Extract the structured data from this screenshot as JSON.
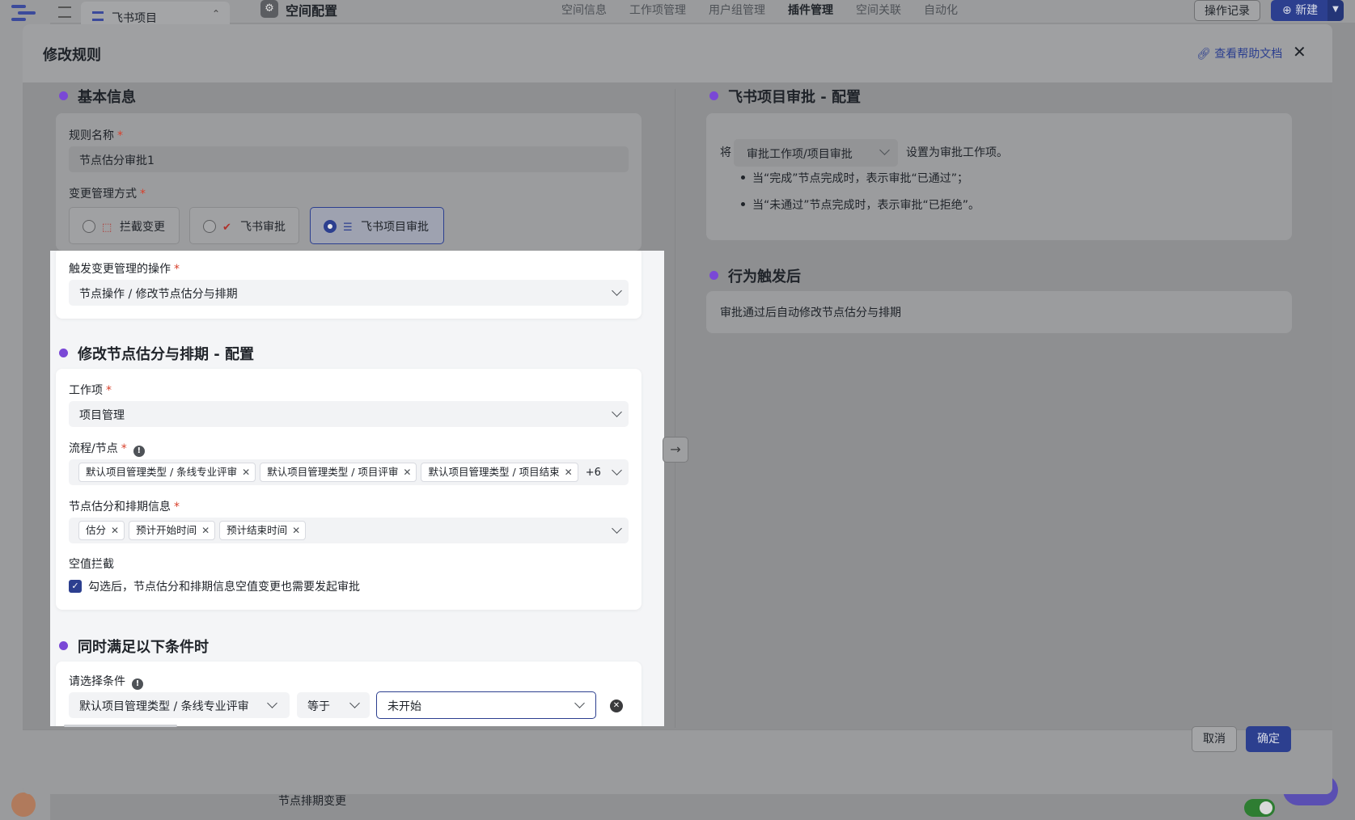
{
  "app": {
    "project_name": "飞书项目",
    "space_title": "空间配置",
    "tabs": [
      "空间信息",
      "工作项管理",
      "用户组管理",
      "插件管理",
      "空间关联",
      "自动化"
    ],
    "active_tab": "插件管理",
    "op_log": "操作记录",
    "new_button": "新建",
    "bottom_row": "节点排期变更"
  },
  "modal": {
    "title": "修改规则",
    "help_link": "查看帮助文档",
    "close": "✕",
    "cancel": "取消",
    "confirm": "确定"
  },
  "basic": {
    "section_title": "基本信息",
    "rule_name_label": "规则名称",
    "rule_name_value": "节点估分审批1",
    "change_mode_label": "变更管理方式",
    "modes": [
      {
        "label": "拦截变更",
        "selected": false
      },
      {
        "label": "飞书审批",
        "selected": false
      },
      {
        "label": "飞书项目审批",
        "selected": true
      }
    ],
    "trigger_label": "触发变更管理的操作",
    "trigger_value": "节点操作 / 修改节点估分与排期"
  },
  "config": {
    "section_title": "修改节点估分与排期 - 配置",
    "workitem_label": "工作项",
    "workitem_value": "项目管理",
    "flow_label": "流程/节点",
    "flow_tags": [
      "默认项目管理类型 / 条线专业评审",
      "默认项目管理类型 / 项目评审",
      "默认项目管理类型 / 项目结束"
    ],
    "flow_more": "+6",
    "schedule_label": "节点估分和排期信息",
    "schedule_tags": [
      "估分",
      "预计开始时间",
      "预计结束时间"
    ],
    "null_label": "空值拦截",
    "null_checkbox_text": "勾选后，节点估分和排期信息空值变更也需要发起审批",
    "null_checked": true
  },
  "conditions": {
    "section_title": "同时满足以下条件时",
    "select_label": "请选择条件",
    "field_value": "默认项目管理类型 / 条线专业评审",
    "operator_value": "等于",
    "status_value": "未开始"
  },
  "approval": {
    "section_title": "飞书项目审批 - 配置",
    "prefix": "将",
    "select_value": "审批工作项/项目审批",
    "suffix": "设置为审批工作项。",
    "bullets": [
      "当“完成”节点完成时，表示审批“已通过”；",
      "当“未通过”节点完成时，表示审批“已拒绝”。"
    ]
  },
  "after": {
    "section_title": "行为触发后",
    "text": "审批通过后自动修改节点估分与排期"
  },
  "colors": {
    "accent": "#2c3f8f",
    "dot": "#7a48d6",
    "required": "#d8402b"
  }
}
